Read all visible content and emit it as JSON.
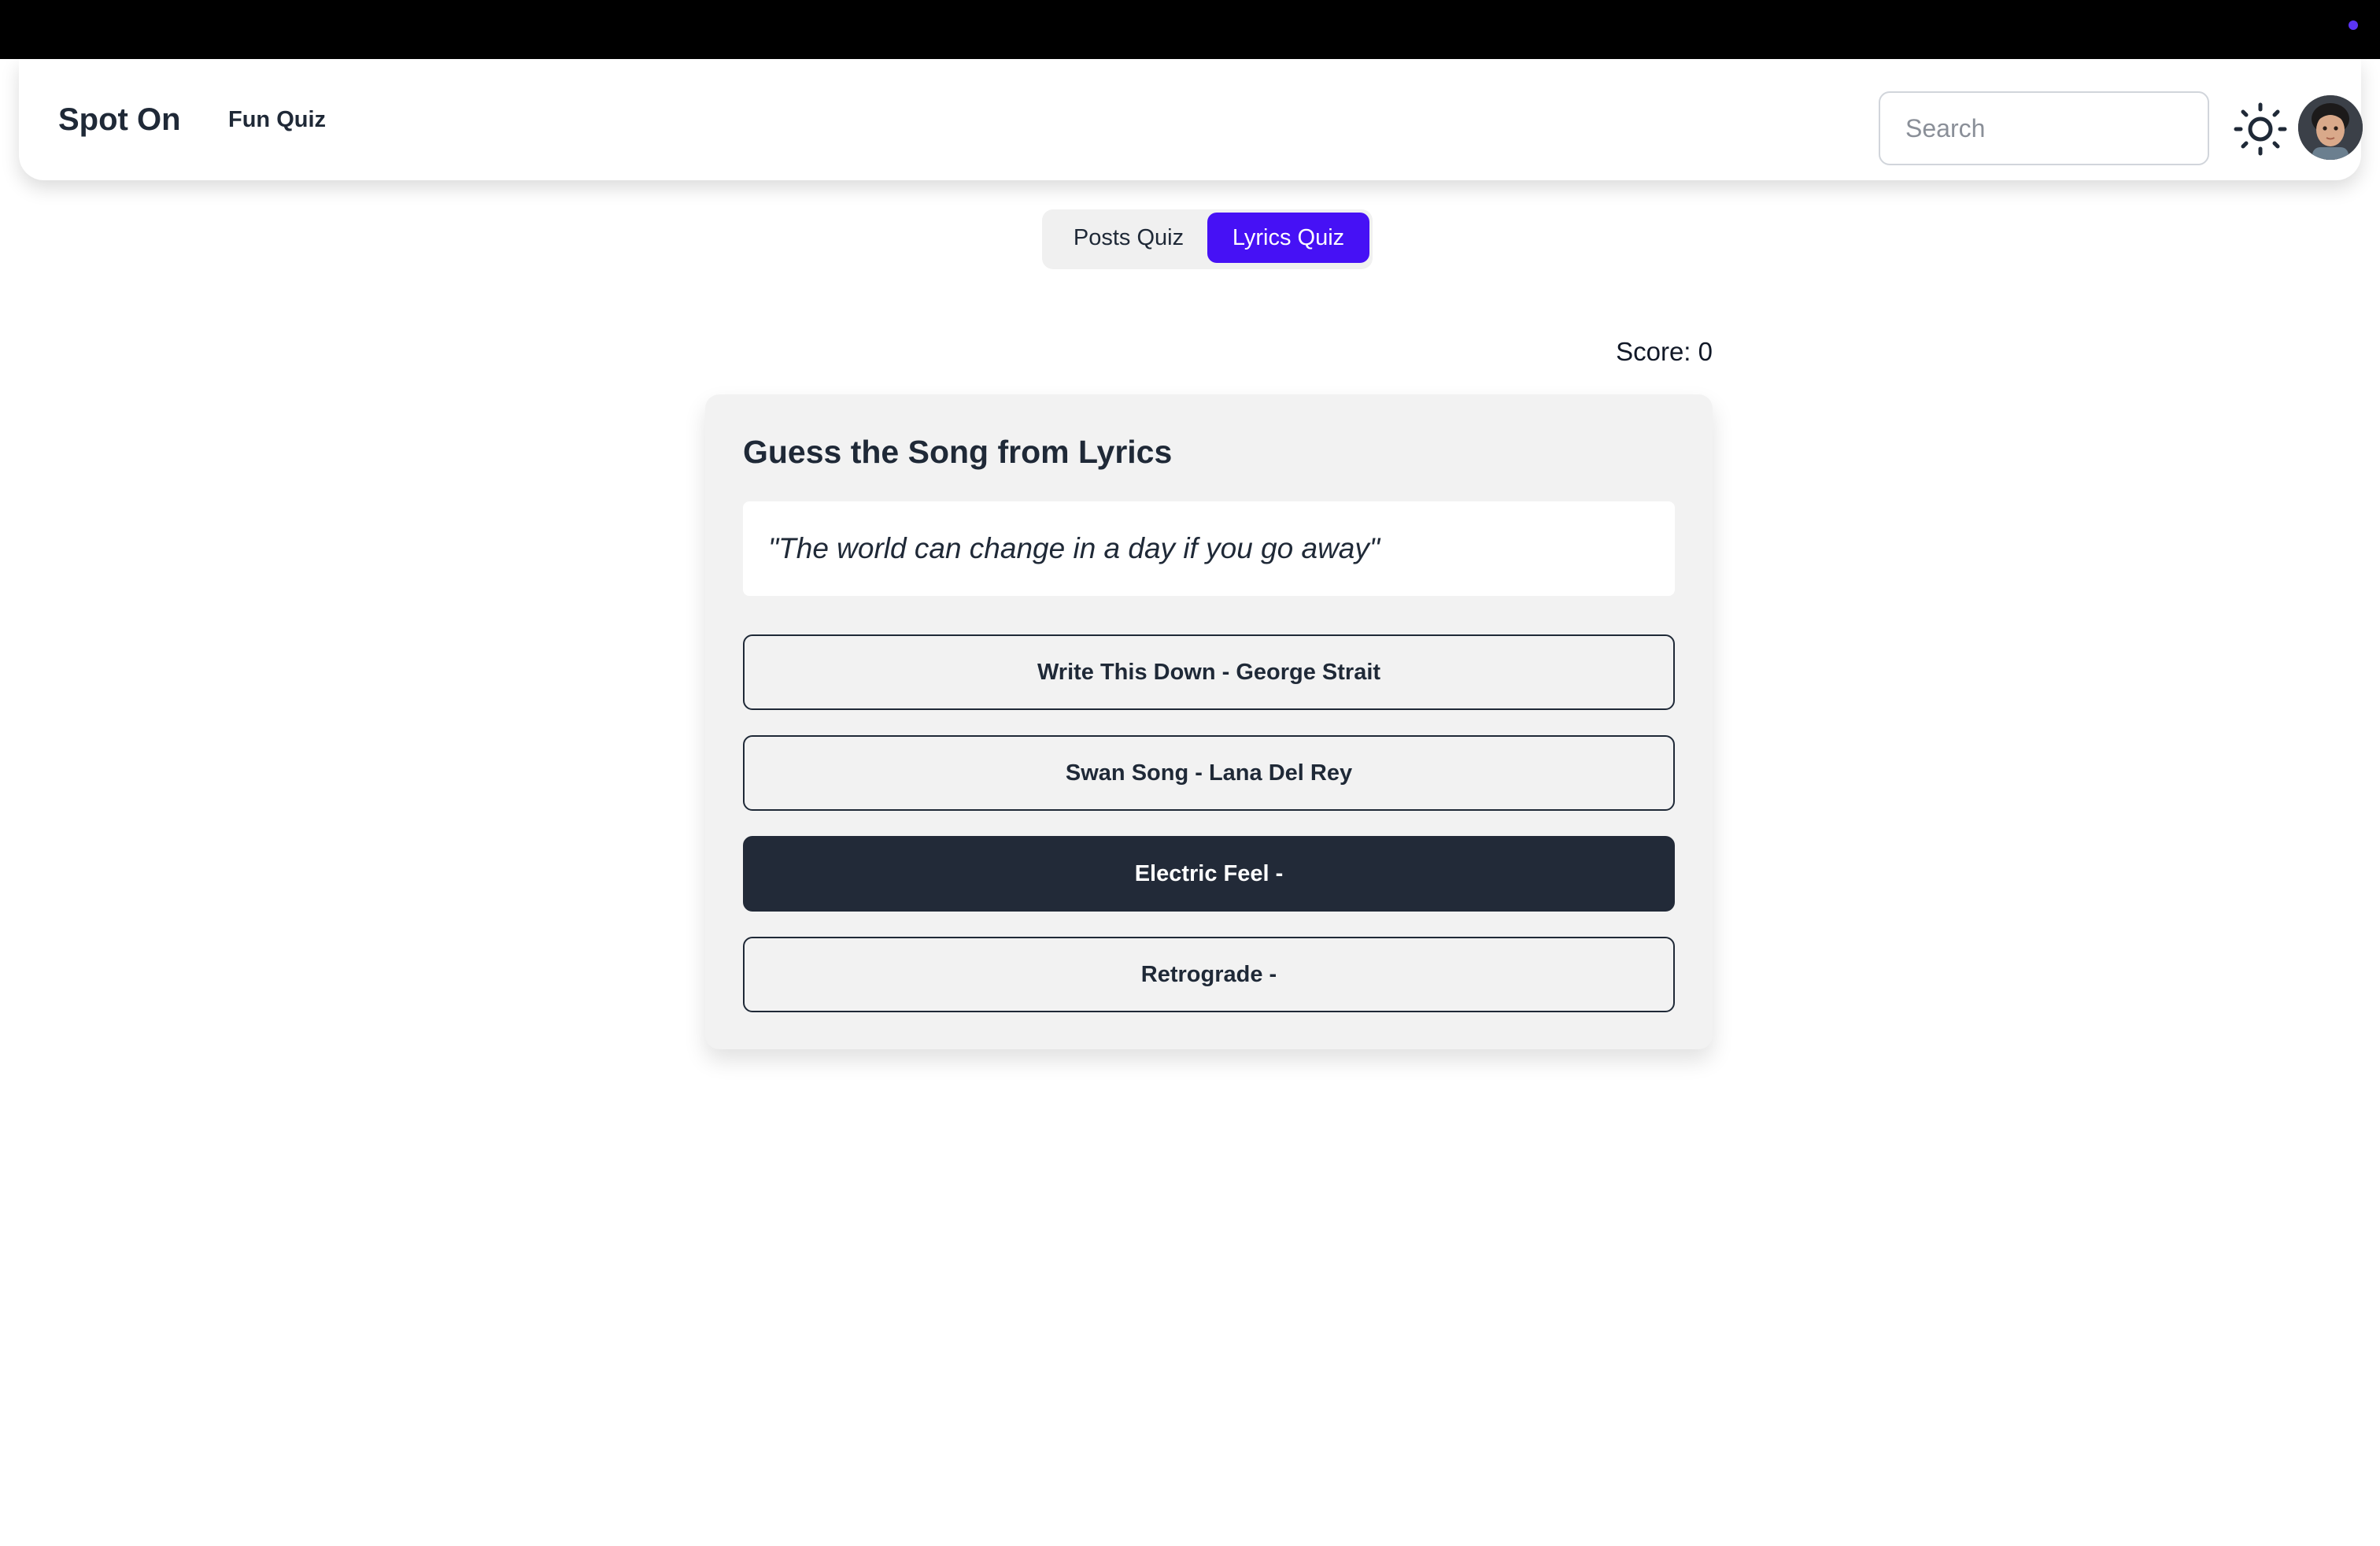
{
  "navbar": {
    "brand": "Spot On",
    "link": "Fun Quiz",
    "search_placeholder": "Search",
    "theme_icon": "sun-icon",
    "avatar_icon": "user-avatar"
  },
  "tabs": [
    {
      "label": "Posts Quiz",
      "active": false
    },
    {
      "label": "Lyrics Quiz",
      "active": true
    }
  ],
  "score": "Score: 0",
  "quiz": {
    "title": "Guess the Song from Lyrics",
    "lyric": "\"The world can change in a day if you go away\"",
    "options": [
      {
        "label": "Write This Down - George Strait",
        "selected": false
      },
      {
        "label": "Swan Song - Lana Del Rey",
        "selected": false
      },
      {
        "label": "Electric Feel -",
        "selected": true
      },
      {
        "label": "Retrograde -",
        "selected": false
      }
    ]
  },
  "colors": {
    "accent": "#4611f5",
    "selected_option": "#222a38",
    "topbar": "#000000",
    "card_background": "#f2f2f2"
  }
}
